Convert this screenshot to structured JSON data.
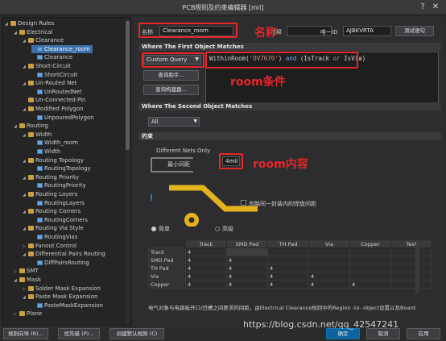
{
  "window": {
    "title": "PCB规则及约束编辑器 [mil]",
    "help_glyph": "?",
    "close_glyph": "✕"
  },
  "tree": {
    "items": [
      {
        "label": "Design Rules",
        "icon": "folder-icon",
        "arrow": "◢",
        "selected": false
      },
      {
        "label": "Electrical",
        "icon": "folder-icon",
        "arrow": "◢",
        "selected": false
      },
      {
        "label": "Clearance",
        "icon": "folder-icon",
        "arrow": "◢",
        "selected": false
      },
      {
        "label": "Clearance_room",
        "icon": "rule-icon",
        "arrow": "",
        "selected": true
      },
      {
        "label": "Clearance",
        "icon": "rule-icon",
        "arrow": "",
        "selected": false
      },
      {
        "label": "Short-Circuit",
        "icon": "folder-icon",
        "arrow": "◢",
        "selected": false
      },
      {
        "label": "ShortCircuit",
        "icon": "rule-icon",
        "arrow": "",
        "selected": false
      },
      {
        "label": "Un-Routed Net",
        "icon": "folder-icon",
        "arrow": "◢",
        "selected": false
      },
      {
        "label": "UnRoutedNet",
        "icon": "rule-icon",
        "arrow": "",
        "selected": false
      },
      {
        "label": "Un-Connected Pin",
        "icon": "folder-icon",
        "arrow": "",
        "selected": false
      },
      {
        "label": "Modified Polygon",
        "icon": "folder-icon",
        "arrow": "◢",
        "selected": false
      },
      {
        "label": "UnpouredPolygon",
        "icon": "rule-icon",
        "arrow": "",
        "selected": false
      },
      {
        "label": "Routing",
        "icon": "folder-icon",
        "arrow": "◢",
        "selected": false
      },
      {
        "label": "Width",
        "icon": "folder-icon",
        "arrow": "◢",
        "selected": false
      },
      {
        "label": "Width_room",
        "icon": "rule-icon",
        "arrow": "",
        "selected": false
      },
      {
        "label": "Width",
        "icon": "rule-icon",
        "arrow": "",
        "selected": false
      },
      {
        "label": "Routing Topology",
        "icon": "folder-icon",
        "arrow": "◢",
        "selected": false
      },
      {
        "label": "RoutingTopology",
        "icon": "rule-icon",
        "arrow": "",
        "selected": false
      },
      {
        "label": "Routing Priority",
        "icon": "folder-icon",
        "arrow": "◢",
        "selected": false
      },
      {
        "label": "RoutingPriority",
        "icon": "rule-icon",
        "arrow": "",
        "selected": false
      },
      {
        "label": "Routing Layers",
        "icon": "folder-icon",
        "arrow": "◢",
        "selected": false
      },
      {
        "label": "RoutingLayers",
        "icon": "rule-icon",
        "arrow": "",
        "selected": false
      },
      {
        "label": "Routing Corners",
        "icon": "folder-icon",
        "arrow": "◢",
        "selected": false
      },
      {
        "label": "RoutingCorners",
        "icon": "rule-icon",
        "arrow": "",
        "selected": false
      },
      {
        "label": "Routing Via Style",
        "icon": "folder-icon",
        "arrow": "◢",
        "selected": false
      },
      {
        "label": "RoutingVias",
        "icon": "rule-icon",
        "arrow": "",
        "selected": false
      },
      {
        "label": "Fanout Control",
        "icon": "folder-icon",
        "arrow": "▷",
        "selected": false
      },
      {
        "label": "Differential Pairs Routing",
        "icon": "folder-icon",
        "arrow": "◢",
        "selected": false
      },
      {
        "label": "DiffPairsRouting",
        "icon": "rule-icon",
        "arrow": "",
        "selected": false
      },
      {
        "label": "SMT",
        "icon": "folder-icon",
        "arrow": "▷",
        "selected": false
      },
      {
        "label": "Mask",
        "icon": "folder-icon",
        "arrow": "◢",
        "selected": false
      },
      {
        "label": "Solder Mask Expansion",
        "icon": "folder-icon",
        "arrow": "▷",
        "selected": false
      },
      {
        "label": "Paste Mask Expansion",
        "icon": "folder-icon",
        "arrow": "◢",
        "selected": false
      },
      {
        "label": "PasteMaskExpansion",
        "icon": "rule-icon",
        "arrow": "",
        "selected": false
      },
      {
        "label": "Plane",
        "icon": "folder-icon",
        "arrow": "▷",
        "selected": false
      }
    ]
  },
  "rule": {
    "name_label": "名称",
    "name_value": "Clearance_room",
    "comment_label": "注释",
    "comment_value": "",
    "uid_label": "唯一ID",
    "uid_value": "AJBKVRTA",
    "test_button": "测试语句"
  },
  "first_object": {
    "header": "Where The First Object Matches",
    "query_type": "Custom Query",
    "query_helper_button": "查询助手...",
    "query_builder_button": "查询构建器...",
    "query_parts": [
      {
        "text": "WithinRoom(",
        "kind": "plain"
      },
      {
        "text": "'OV7670'",
        "kind": "string"
      },
      {
        "text": ") ",
        "kind": "plain"
      },
      {
        "text": "and",
        "kind": "keyword"
      },
      {
        "text": " (IsTrack ",
        "kind": "plain"
      },
      {
        "text": "or",
        "kind": "keyword"
      },
      {
        "text": " IsVia)",
        "kind": "plain"
      }
    ]
  },
  "second_object": {
    "header": "Where The Second Object Matches",
    "scope": "All"
  },
  "constraints": {
    "header": "约束",
    "net_scope": "Different Nets Only",
    "min_clearance_label": "最小间距",
    "min_clearance_value": "4mil",
    "ignore_pads_label": "忽略同一封装内的焊盘间距",
    "mode_simple": "简单",
    "mode_advanced": "高级",
    "mode_selected": "simple",
    "matrix": {
      "columns": [
        "Track",
        "SMD Pad",
        "TH Pad",
        "Via",
        "Copper",
        "Text"
      ],
      "rows": [
        {
          "label": "Track",
          "cells": [
            "4"
          ]
        },
        {
          "label": "SMD Pad",
          "cells": [
            "4",
            "4"
          ]
        },
        {
          "label": "TH Pad",
          "cells": [
            "4",
            "4",
            "4"
          ]
        },
        {
          "label": "Via",
          "cells": [
            "4",
            "4",
            "4",
            "4"
          ]
        },
        {
          "label": "Copper",
          "cells": [
            "4",
            "4",
            "4",
            "4",
            "4"
          ]
        }
      ]
    },
    "description": "电气对象与电路板开口/凹槽之间要求的间距。由Electrical Clearance规则中的Region -to- object设置以及Board"
  },
  "annotations": {
    "name": "名称",
    "room_condition": "room条件",
    "room_content": "room内容"
  },
  "footer": {
    "rule_wizard": "规则向导 (R)...",
    "priorities": "优先级 (P)...",
    "create_default": "创建默认规则 (C)",
    "ok": "确定",
    "cancel": "取消",
    "apply": "应用"
  },
  "watermark": "https://blog.csdn.net/qq_42547241",
  "colors": {
    "annotation_red": "#e5262a",
    "selection_blue": "#3c6fa8",
    "pad_yellow": "#e3b31d"
  }
}
